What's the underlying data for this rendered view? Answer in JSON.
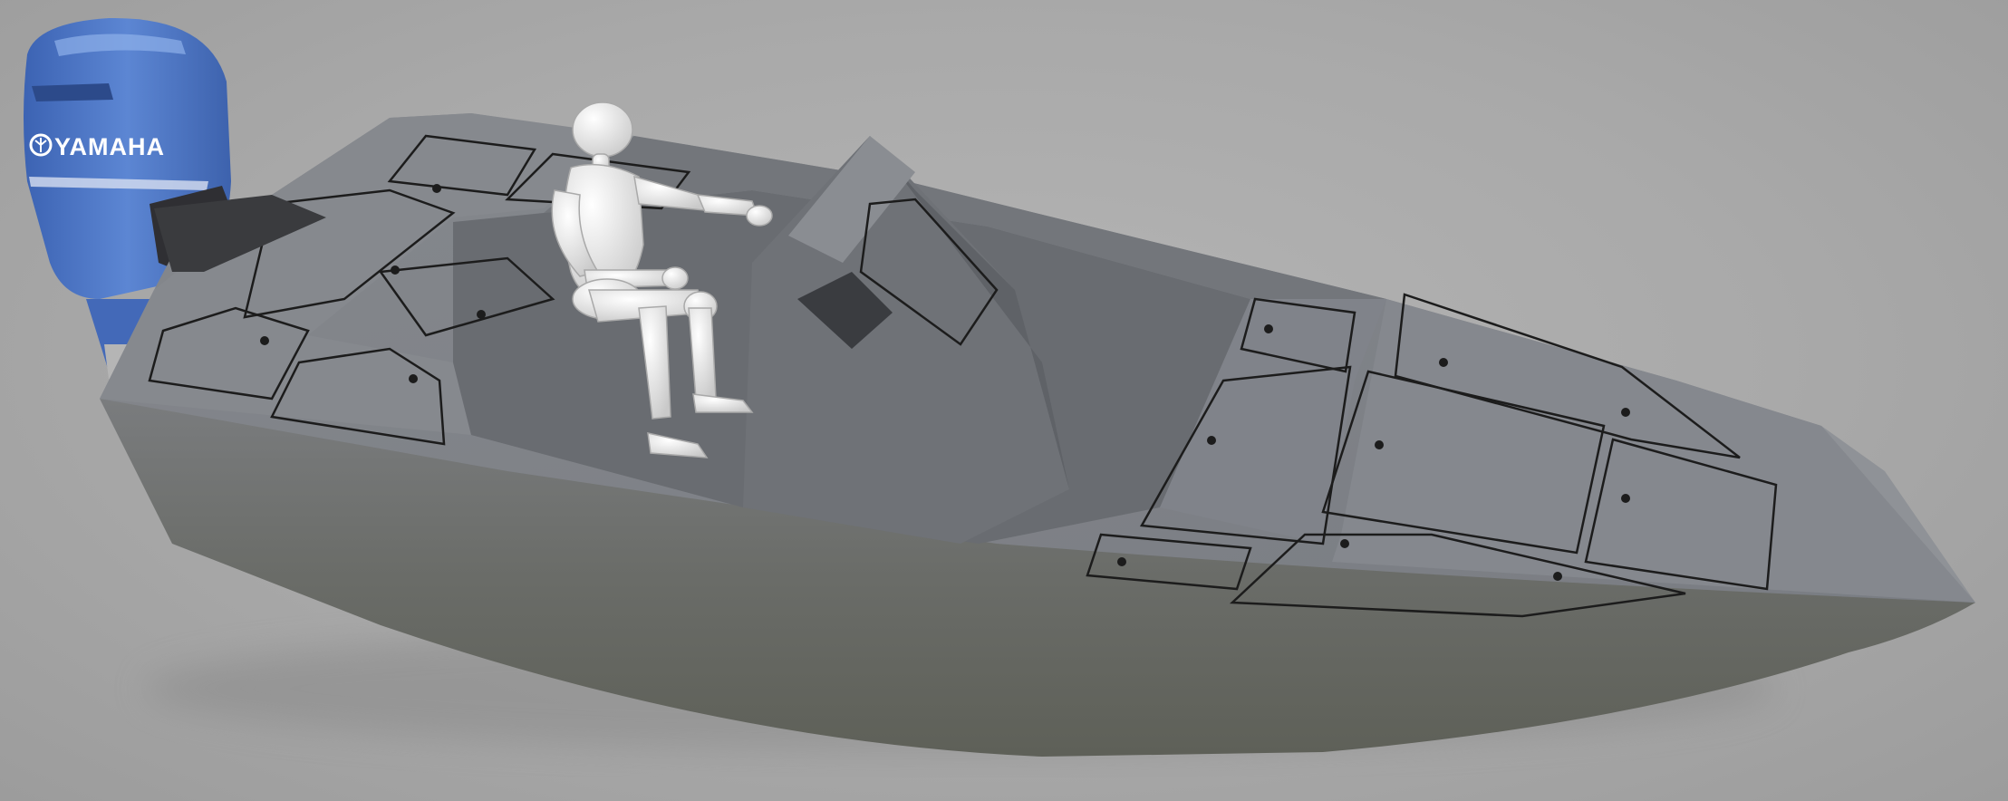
{
  "scene": {
    "subject": "boat-render",
    "outboard_motor": {
      "brand_text": "YAMAHA",
      "color": "#4f79c9"
    },
    "hull": {
      "deck_color": "#7b7e84",
      "side_color": "#6e6f70"
    },
    "mannequin": {
      "color": "#e8e8e8",
      "pose": "seated"
    },
    "background": "#aaaaaa"
  }
}
